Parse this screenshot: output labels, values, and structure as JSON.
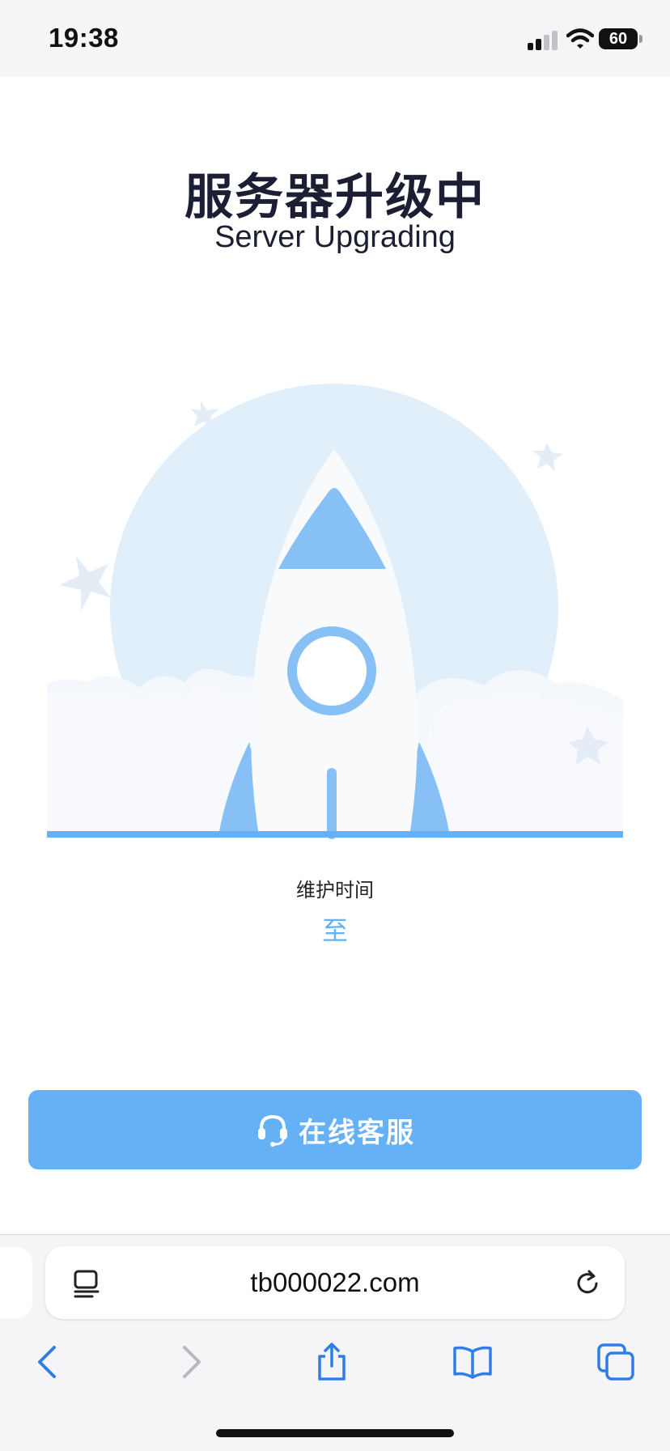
{
  "status_bar": {
    "time": "19:38",
    "battery": "60"
  },
  "page": {
    "title": "服务器升级中",
    "subtitle": "Server Upgrading",
    "maintenance_label": "维护时间",
    "maintenance_time": "至",
    "support_button": "在线客服"
  },
  "browser": {
    "url": "tb000022.com"
  },
  "colors": {
    "accent": "#66b1f5",
    "rocket_blue": "#86c0f5",
    "circle_bg": "#e1effb",
    "title": "#1c1f33"
  }
}
